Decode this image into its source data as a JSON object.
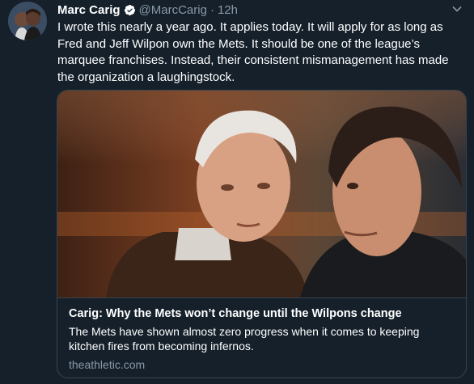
{
  "tweet": {
    "author_name": "Marc Carig",
    "handle": "@MarcCarig",
    "separator": "·",
    "time": "12h",
    "text": "I wrote this nearly a year ago. It applies today. It will apply for as long as Fred and Jeff Wilpon own the Mets. It should be one of the league’s marquee franchises. Instead, their consistent mismanagement has made the organization a laughingstock."
  },
  "card": {
    "title": "Carig: Why the Mets won’t change until the Wilpons change",
    "description": "The Mets have shown almost zero progress when it comes to keeping kitchen fires from becoming infernos.",
    "domain": "theathletic.com"
  },
  "colors": {
    "background": "#15202b",
    "secondary_text": "#8899a6",
    "border": "#38444d",
    "verified_badge": "#ffffff"
  },
  "icons": [
    "verified-badge-icon",
    "chevron-down-icon"
  ]
}
